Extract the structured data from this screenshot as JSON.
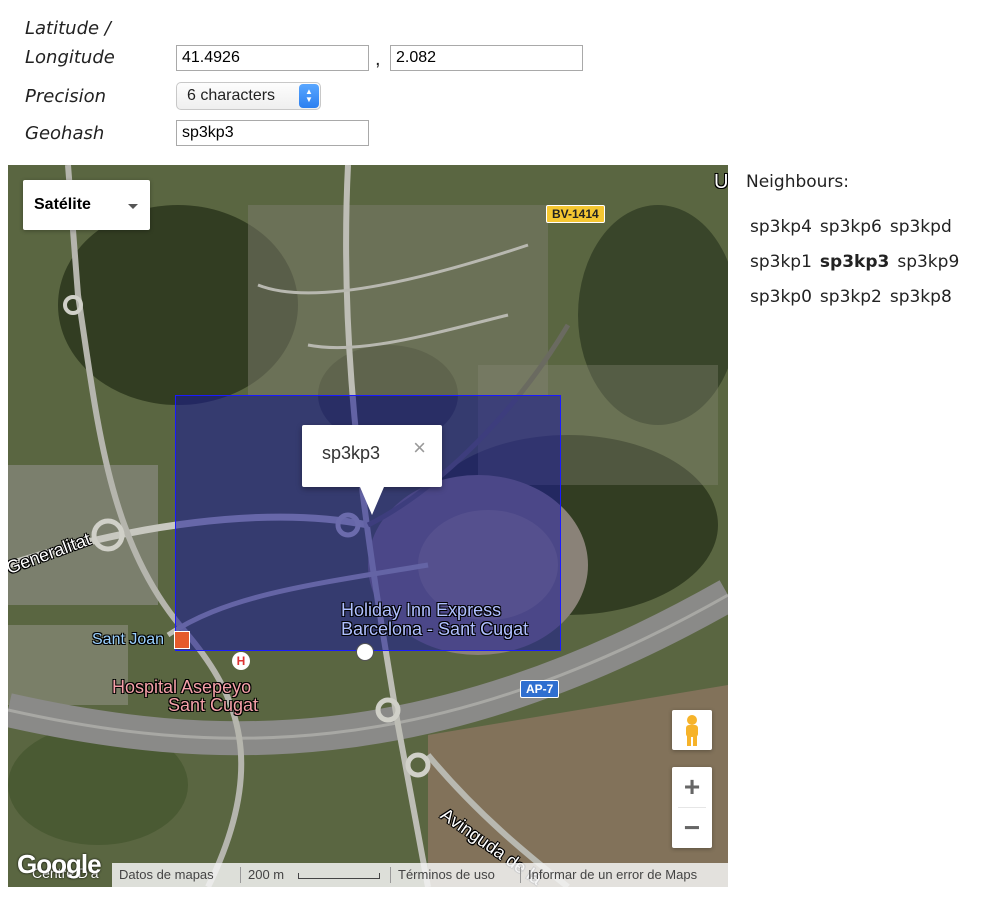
{
  "form": {
    "latlon_label_line1": "Latitude /",
    "latlon_label_line2": "Longitude",
    "latitude_value": "41.4926",
    "comma": ",",
    "longitude_value": "2.082",
    "precision_label": "Precision",
    "precision_value": "6 characters",
    "geohash_label": "Geohash",
    "geohash_value": "sp3kp3"
  },
  "map": {
    "map_type": "Satélite",
    "info_window_title": "sp3kp3",
    "info_close": "×",
    "road_shield_1": "BV-1414",
    "road_shield_2": "AP-7",
    "labels": {
      "generalitat": "Generalitat",
      "sant_joan": "Sant Joan",
      "hospital_line1": "Hospital Asepeyo",
      "hospital_line2": "Sant Cugat",
      "hotel_line1": "Holiday Inn Express",
      "hotel_line2": "Barcelona - Sant Cugat",
      "avinguda": "Avinguda de la",
      "edge_letters": "U"
    },
    "zoom_in": "+",
    "zoom_out": "−",
    "logo": "Google",
    "cut_label": "Centre D'a",
    "attribution": {
      "map_data": "Datos de mapas",
      "scale": "200 m",
      "terms": "Términos de uso",
      "report": "Informar de un error de Maps"
    },
    "colors": {
      "geohash_fill": "#181896",
      "geohash_border": "#1a1aff"
    }
  },
  "neighbours": {
    "title": "Neighbours:",
    "rows": [
      [
        "sp3kp4",
        "sp3kp6",
        "sp3kpd"
      ],
      [
        "sp3kp1",
        "sp3kp3",
        "sp3kp9"
      ],
      [
        "sp3kp0",
        "sp3kp2",
        "sp3kp8"
      ]
    ]
  }
}
